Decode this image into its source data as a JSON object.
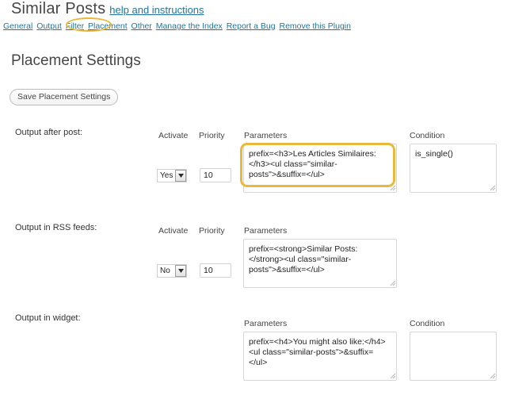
{
  "header": {
    "plugin_title": "Similar Posts",
    "help_link": "help and instructions"
  },
  "nav": {
    "links": [
      {
        "label": "General"
      },
      {
        "label": "Output"
      },
      {
        "label": "Filter"
      },
      {
        "label": "Placement"
      },
      {
        "label": "Other"
      },
      {
        "label": "Manage the Index"
      },
      {
        "label": "Report a Bug"
      },
      {
        "label": "Remove this Plugin"
      }
    ],
    "highlighted": "Placement"
  },
  "page": {
    "heading": "Placement Settings",
    "save_label": "Save Placement Settings"
  },
  "columns": {
    "activate": "Activate",
    "priority": "Priority",
    "parameters": "Parameters",
    "condition": "Condition"
  },
  "sections": [
    {
      "label": "Output after post:",
      "has_activate": true,
      "activate_value": "Yes",
      "priority_value": "10",
      "parameters": "prefix=<h3>Les Articles Similaires:</h3><ul class=\"similar-posts\">&suffix=</ul>",
      "has_condition": true,
      "condition": "is_single()",
      "highlighted": true
    },
    {
      "label": "Output in RSS feeds:",
      "has_activate": true,
      "activate_value": "No",
      "priority_value": "10",
      "parameters": "prefix=<strong>Similar Posts:</strong><ul class=\"similar-posts\">&suffix=</ul>",
      "has_condition": false,
      "condition": "",
      "highlighted": false
    },
    {
      "label": "Output in widget:",
      "has_activate": false,
      "activate_value": "",
      "priority_value": "",
      "parameters": "prefix=<h4>You might also like:</h4><ul class=\"similar-posts\">&suffix=</ul>",
      "has_condition": true,
      "condition": "",
      "highlighted": false
    }
  ],
  "colors": {
    "link": "#21759b",
    "highlight": "#e8b93c",
    "heading": "#464646"
  }
}
